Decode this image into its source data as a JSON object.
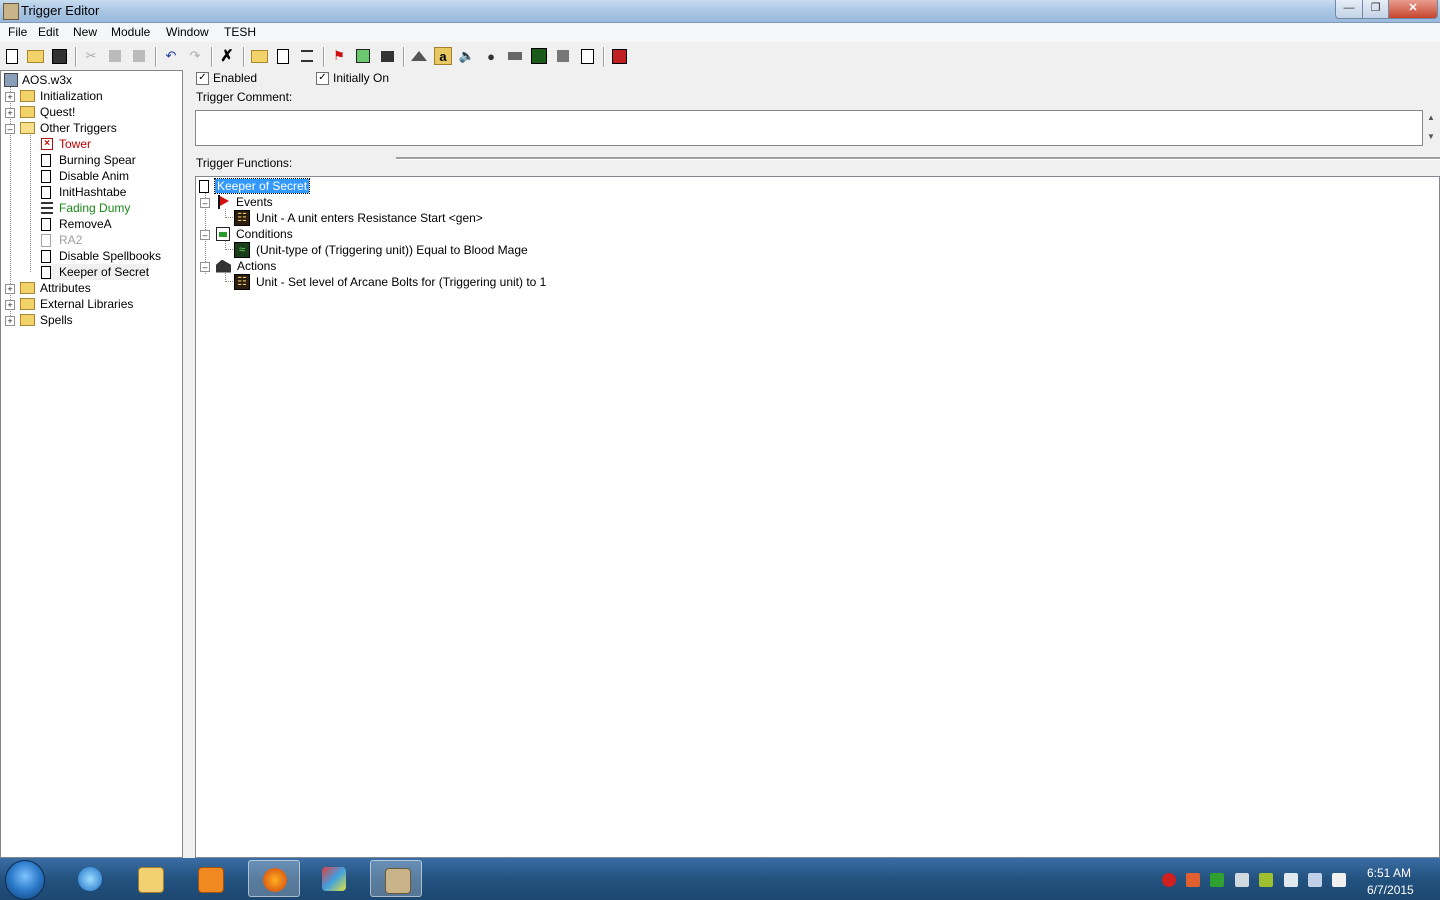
{
  "window": {
    "title": "Trigger Editor"
  },
  "menu": [
    "File",
    "Edit",
    "New",
    "Module",
    "Window",
    "TESH"
  ],
  "tree": {
    "root": "AOS.w3x",
    "folders_top": [
      {
        "label": "Initialization",
        "expanded": false
      },
      {
        "label": "Quest!",
        "expanded": false
      },
      {
        "label": "Other Triggers",
        "expanded": true
      }
    ],
    "triggers": [
      {
        "label": "Tower",
        "color": "#c00000",
        "state": "error"
      },
      {
        "label": "Burning Spear",
        "color": "#000000",
        "state": "normal"
      },
      {
        "label": "Disable Anim",
        "color": "#000000",
        "state": "normal"
      },
      {
        "label": "InitHashtabe",
        "color": "#000000",
        "state": "normal"
      },
      {
        "label": "Fading Dumy",
        "color": "#1a8a1a",
        "state": "custom-text"
      },
      {
        "label": "RemoveA",
        "color": "#000000",
        "state": "normal"
      },
      {
        "label": "RA2",
        "color": "#a0a0a0",
        "state": "disabled"
      },
      {
        "label": "Disable Spellbooks",
        "color": "#000000",
        "state": "normal"
      },
      {
        "label": "Keeper of Secret",
        "color": "#000000",
        "state": "selected"
      }
    ],
    "folders_bottom": [
      {
        "label": "Attributes",
        "expanded": false
      },
      {
        "label": "External Libraries",
        "expanded": false
      },
      {
        "label": "Spells",
        "expanded": false
      }
    ]
  },
  "options": {
    "enabled_label": "Enabled",
    "enabled_checked": "✓",
    "initially_on_label": "Initially On",
    "initially_on_checked": "✓"
  },
  "comment": {
    "label": "Trigger Comment:",
    "value": ""
  },
  "functions": {
    "label": "Trigger Functions:",
    "trigger_name": "Keeper of Secret",
    "events_label": "Events",
    "events": [
      "Unit - A unit enters Resistance Start <gen>"
    ],
    "conditions_label": "Conditions",
    "conditions": [
      "(Unit-type of (Triggering unit)) Equal to Blood Mage"
    ],
    "actions_label": "Actions",
    "actions": [
      "Unit - Set level of Arcane Bolts  for (Triggering unit) to 1"
    ]
  },
  "taskbar": {
    "time": "6:51 AM",
    "date": "6/7/2015",
    "apps": [
      "start-orb",
      "internet-explorer-icon",
      "file-explorer-icon",
      "media-player-icon",
      "firefox-icon",
      "paint-icon",
      "world-editor-icon"
    ]
  },
  "colors": {
    "selection": "#3399ff",
    "error": "#c00000",
    "custom": "#1a8a1a",
    "disabled": "#a0a0a0"
  }
}
